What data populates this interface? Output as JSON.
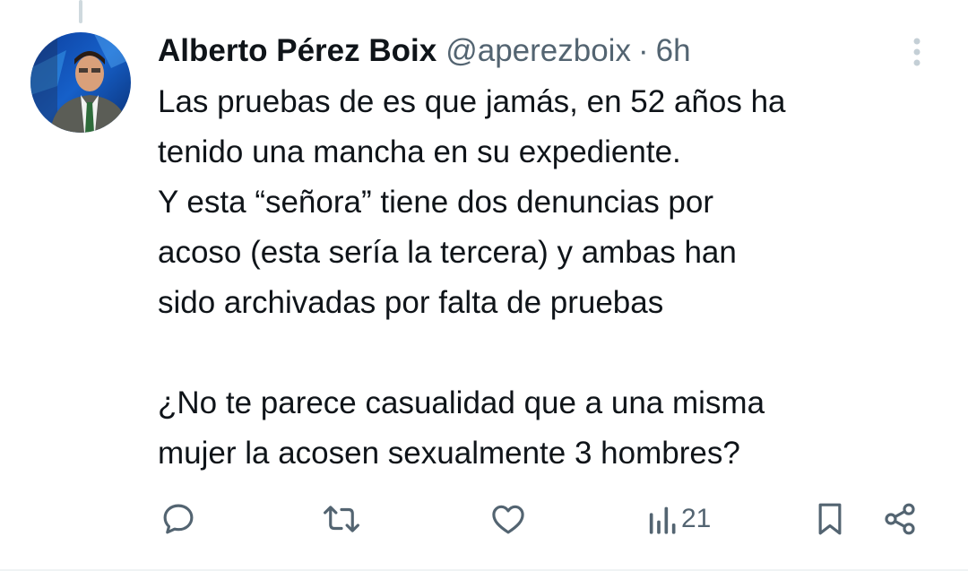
{
  "tweet": {
    "author_name": "Alberto Pérez Boix",
    "handle": "@aperezboix",
    "separator": "·",
    "time": "6h",
    "text": "Las pruebas de es que jamás, en 52 años ha\ntenido una mancha en su expediente.\nY esta “señora” tiene dos denuncias por\nacoso (esta sería la tercera) y ambas han\nsido archivadas por falta de pruebas\n\n¿No te parece casualidad que a una misma\nmujer la acosen sexualmente 3 hombres?",
    "views": "21"
  },
  "icons": {
    "more": "more-vertical-icon",
    "reply": "reply-icon",
    "retweet": "retweet-icon",
    "like": "heart-icon",
    "views": "views-chart-icon",
    "bookmark": "bookmark-icon",
    "share": "share-icon"
  },
  "colors": {
    "text_primary": "#0f1419",
    "text_secondary": "#536471",
    "thread_line": "#cfd9de"
  }
}
